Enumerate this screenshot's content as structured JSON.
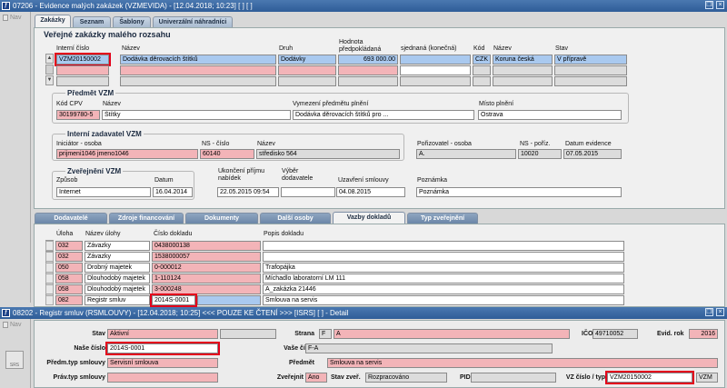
{
  "win1": {
    "title": "07206 - Evidence malých zakázek (VZMEVIDA) - [12.04.2018; 10:23] [ ] [ ]",
    "tabs": [
      "Zakázky",
      "Seznam",
      "Šablony",
      "Univerzální náhradníci"
    ],
    "nav_label": "Nav",
    "section_title": "Veřejné zakázky malého rozsahu",
    "cols": [
      "Interní číslo",
      "Název",
      "Druh",
      "Hodnota předpokládaná",
      "sjednaná (konečná)",
      "Kód",
      "Název",
      "Stav"
    ],
    "row": {
      "interni": "VZM20150002",
      "nazev": "Dodávka děrovacích štítků",
      "druh": "Dodávky",
      "hodnota": "693 000.00",
      "sjednana": "",
      "kod": "CZK",
      "mena": "Koruna česká",
      "stav": "V přípravě"
    },
    "predmet": {
      "title": "Předmět VZM",
      "l_kod": "Kód CPV",
      "l_nazev": "Název",
      "l_vymezeni": "Vymezení předmětu plnění",
      "l_misto": "Místo plnění",
      "kod": "30199780-5",
      "nazev": "Štítky",
      "vymezeni": "Dodávka děrovacích štítků pro ...",
      "misto": "Ostrava"
    },
    "zadavatel": {
      "title": "Interní zadavatel VZM",
      "l_iniciator": "Iniciátor - osoba",
      "l_ns": "NS - číslo",
      "l_nazev": "Název",
      "iniciator": "prijmeni1046 jmeno1046",
      "ns": "60140",
      "nazev": "středisko 564",
      "l_porizovatel": "Pořizovatel - osoba",
      "l_nspor": "NS - poříz.",
      "l_datum": "Datum evidence",
      "porizovatel": "A.",
      "nspor": "10020",
      "datum": "07.05.2015"
    },
    "zverejneni": {
      "title": "Zveřejnění VZM",
      "l_zpusob": "Způsob",
      "l_datum": "Datum",
      "zpusob": "Internet",
      "datum": "16.04.2014",
      "l_ukonceni": "Ukončení příjmu nabídek",
      "ukonceni": "22.05.2015 09:54",
      "l_vyber": "Výběr dodavatele",
      "vyber": "",
      "l_uzavreni": "Uzavření smlouvy",
      "uzavreni": "04.08.2015",
      "l_poznamka": "Poznámka",
      "poznamka": "Poznámka"
    },
    "tabs2": [
      "Dodavatelé",
      "Zdroje financování",
      "Dokumenty",
      "Další osoby",
      "Vazby dokladů",
      "Typ zveřejnění"
    ],
    "vazby_cols": [
      "Úloha",
      "Název úlohy",
      "Číslo dokladu",
      "Popis dokladu"
    ],
    "vazby": [
      {
        "uloha": "032",
        "nazev": "Závazky",
        "cislo": "0438000138",
        "popis": ""
      },
      {
        "uloha": "032",
        "nazev": "Závazky",
        "cislo": "1538000057",
        "popis": ""
      },
      {
        "uloha": "050",
        "nazev": "Drobný majetek",
        "cislo": "0-000012",
        "popis": "Trafopájka"
      },
      {
        "uloha": "058",
        "nazev": "Dlouhodobý majetek",
        "cislo": "1-110124",
        "popis": "Míchadlo laboratorní LM 111"
      },
      {
        "uloha": "058",
        "nazev": "Dlouhodobý majetek",
        "cislo": "3-000248",
        "popis": "A_zakázka 21446"
      },
      {
        "uloha": "082",
        "nazev": "Registr smluv",
        "cislo": "2014S-0001",
        "popis": "Smlouva na servis"
      }
    ]
  },
  "win2": {
    "title": "08202 - Registr smluv (RSMLOUVY) - [12.04.2018; 10:25] <<< POUZE KE ČTENÍ >>> [ISRS] [ ] - Detail",
    "nav_label": "Nav",
    "nav_btn": "SRS",
    "l_stav": "Stav",
    "stav": "Aktivní",
    "l_strana": "Strana",
    "strana_kod": "F",
    "strana": "A",
    "l_ico": "IČO",
    "ico": "49710052",
    "l_evid": "Evid. rok",
    "evid": "2016",
    "l_nase": "Naše číslo",
    "nase": "2014S-0001",
    "l_vase": "Vaše číslo",
    "vase": "F-A",
    "l_predm_typ": "Předm.typ smlouvy",
    "predm_typ": "Servisní smlouva",
    "l_predmet": "Předmět",
    "predmet": "Smlouva na servis",
    "l_prav_typ": "Práv.typ smlouvy",
    "prav_typ": "",
    "l_zverejnit": "Zveřejnit",
    "zverejnit": "Ano",
    "l_stav_zver": "Stav zveř.",
    "stav_zver": "Rozpracováno",
    "l_pid": "PID",
    "pid": "",
    "l_vz": "VZ číslo / typ",
    "vz": "VZM20150002",
    "vz_typ": "VZM"
  }
}
